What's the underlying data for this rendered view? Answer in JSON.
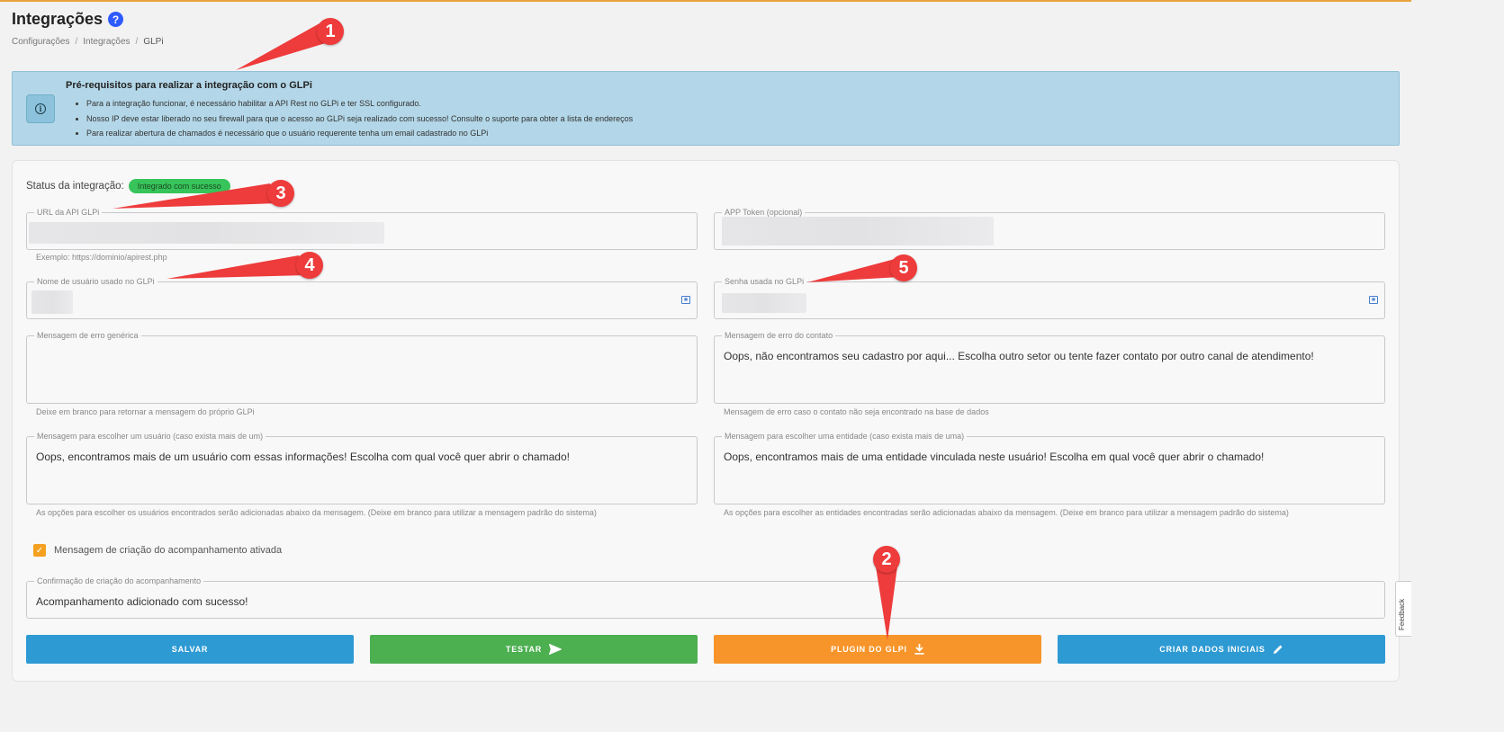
{
  "page": {
    "title": "Integrações",
    "help_icon": "?",
    "breadcrumb": [
      "Configurações",
      "Integrações",
      "GLPi"
    ],
    "breadcrumb_sep": "/"
  },
  "prereq": {
    "icon": "info-icon",
    "title": "Pré-requisitos para realizar a integração com o GLPi",
    "items": [
      "Para a integração funcionar, é necessário habilitar a API Rest no GLPi e ter SSL configurado.",
      "Nosso IP deve estar liberado no seu firewall para que o acesso ao GLPi seja realizado com sucesso! Consulte o suporte para obter a lista de endereços",
      "Para realizar abertura de chamados é necessário que o usuário requerente tenha um email cadastrado no GLPi"
    ]
  },
  "status": {
    "label": "Status da integração:",
    "badge": "Integrado com sucesso",
    "badge_color": "#37c45a"
  },
  "fields": {
    "api_url": {
      "label": "URL da API GLPi",
      "hint": "Exemplo: https://dominio/apirest.php"
    },
    "app_token": {
      "label": "APP Token (opcional)"
    },
    "username": {
      "label": "Nome de usuário usado no GLPi"
    },
    "password": {
      "label": "Senha usada no GLPi"
    },
    "generic_error": {
      "label": "Mensagem de erro genérica",
      "value": "",
      "hint": "Deixe em branco para retornar a mensagem do próprio GLPi"
    },
    "contact_error": {
      "label": "Mensagem de erro do contato",
      "value": "Oops, não encontramos seu cadastro por aqui... Escolha outro setor ou tente fazer contato por outro canal de atendimento!",
      "hint": "Mensagem de erro caso o contato não seja encontrado na base de dados"
    },
    "choose_user": {
      "label": "Mensagem para escolher um usuário (caso exista mais de um)",
      "value": "Oops, encontramos mais de um usuário com essas informações! Escolha com qual você quer abrir o chamado!",
      "hint": "As opções para escolher os usuários encontrados serão adicionadas abaixo da mensagem. (Deixe em branco para utilizar a mensagem padrão do sistema)"
    },
    "choose_entity": {
      "label": "Mensagem para escolher uma entidade (caso exista mais de uma)",
      "value": "Oops, encontramos mais de uma entidade vinculada neste usuário! Escolha em qual você quer abrir o chamado!",
      "hint": "As opções para escolher as entidades encontradas serão adicionadas abaixo da mensagem. (Deixe em branco para utilizar a mensagem padrão do sistema)"
    },
    "followup_confirm": {
      "label": "Confirmação de criação do acompanhamento",
      "value": "Acompanhamento adicionado com sucesso!"
    }
  },
  "followup_toggle": {
    "label": "Mensagem de criação do acompanhamento ativada",
    "checked": true
  },
  "buttons": {
    "save": "SALVAR",
    "test": "TESTAR",
    "plugin": "PLUGIN DO GLPI",
    "initial_data": "CRIAR DADOS INICIAIS"
  },
  "callouts": [
    "1",
    "2",
    "3",
    "4",
    "5"
  ],
  "feedback": "Feedback",
  "colors": {
    "accent_blue": "#2e9ad3",
    "accent_green": "#4caf50",
    "accent_orange": "#f7952a",
    "callout_red": "#ee3b3b",
    "info_bg": "#b3d7e8"
  }
}
